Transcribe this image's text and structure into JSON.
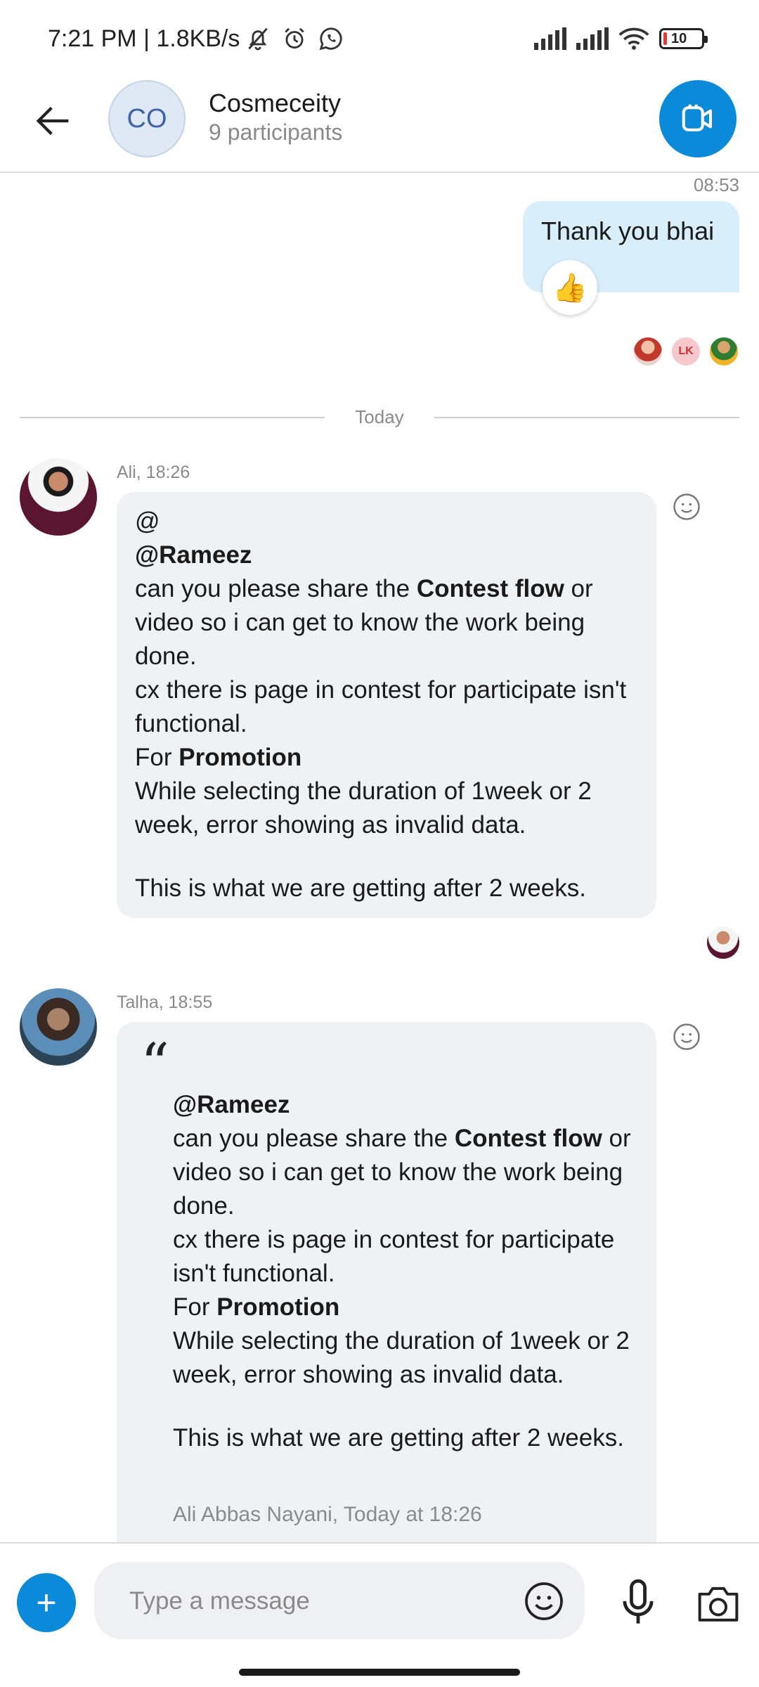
{
  "status_bar": {
    "time": "7:21 PM | 1.8KB/s",
    "battery": "10",
    "icons": [
      "mute-bell-icon",
      "alarm-icon",
      "whatsapp-icon",
      "signal-icon",
      "signal-icon",
      "wifi-icon",
      "battery-icon"
    ]
  },
  "header": {
    "avatar_initials": "CO",
    "title": "Cosmeceity",
    "subtitle": "9 participants",
    "accent": "#0a8ad8"
  },
  "outgoing": {
    "time": "08:53",
    "text": "Thank you bhai",
    "reaction": "👍",
    "seen_lk": "LK"
  },
  "divider": {
    "label": "Today"
  },
  "messages": [
    {
      "meta": "Ali, 18:26",
      "line_at": "@",
      "mention": "@Rameez",
      "l1_pre": "can you please share the ",
      "l1_bold": "Contest flow",
      "l1_post": " or video so i can get to know the work being done.",
      "l2": "cx there is page in contest for participate isn't functional.",
      "l3_pre": "For ",
      "l3_bold": "Promotion",
      "l4": "While selecting the duration of 1week or 2 week, error showing as invalid data.",
      "l5": "This is what we are getting after 2 weeks."
    },
    {
      "meta": "Talha, 18:55",
      "quote_mark": "“",
      "mention": "@Rameez",
      "l1_pre": "can you please share the ",
      "l1_bold": "Contest flow",
      "l1_post": " or video so i can get to know the work being done.",
      "l2": "cx there is page in contest for participate isn't functional.",
      "l3_pre": "For ",
      "l3_bold": "Promotion",
      "l4": "While selecting the duration of 1week or 2 week, error showing as invalid data.",
      "l5": "This is what we are getting after 2 weeks.",
      "signature": "Ali Abbas Nayani, Today at 18:26"
    }
  ],
  "composer": {
    "placeholder": "Type a message",
    "plus": "+"
  }
}
